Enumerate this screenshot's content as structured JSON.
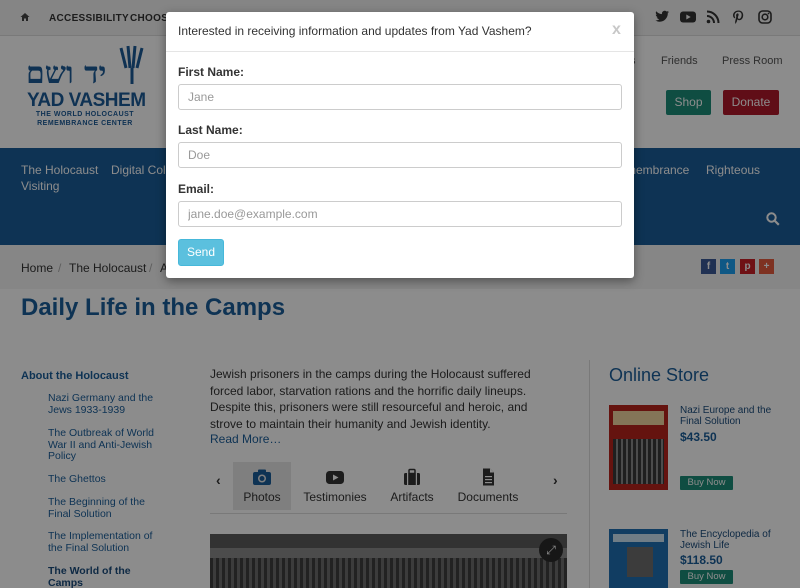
{
  "utility_bar": {
    "links": [
      "ACCESSIBILITY",
      "CHOOSE"
    ],
    "social_icons": [
      "twitter-icon",
      "youtube-icon",
      "rss-icon",
      "pinterest-icon",
      "instagram-icon"
    ]
  },
  "header": {
    "logo_hebrew": "יד ושם",
    "logo_english": "YAD VASHEM",
    "logo_subtitle": "THE WORLD HOLOCAUST REMEMBRANCE CENTER",
    "links": [
      "s",
      "Friends",
      "Press Room"
    ],
    "shop_label": "Shop",
    "donate_label": "Donate"
  },
  "nav": {
    "items_row1": [
      "The Holocaust",
      "Digital Colle",
      "membrance",
      "Righteous"
    ],
    "items_row2": [
      "Visiting"
    ]
  },
  "breadcrumb": {
    "items": [
      "Home",
      "The Holocaust",
      "A"
    ]
  },
  "page_title": "Daily Life in the Camps",
  "sidebar": {
    "heading": "About the Holocaust",
    "items": [
      "Nazi Germany and the Jews 1933-1939",
      "The Outbreak of World War II and Anti-Jewish Policy",
      "The Ghettos",
      "The Beginning of the Final Solution",
      "The Implementation of the Final Solution",
      "The World of the Camps"
    ]
  },
  "main": {
    "intro": "Jewish prisoners in the camps during the Holocaust suffered forced labor, starvation rations and the horrific daily lineups. Despite this, prisoners were still resourceful and heroic, and strove to maintain their humanity and Jewish identity.",
    "read_more": "Read More…",
    "tabs": [
      {
        "label": "Photos",
        "icon": "camera-icon"
      },
      {
        "label": "Testimonies",
        "icon": "youtube-icon"
      },
      {
        "label": "Artifacts",
        "icon": "suitcase-icon"
      },
      {
        "label": "Documents",
        "icon": "document-icon"
      }
    ]
  },
  "store": {
    "title": "Online Store",
    "books": [
      {
        "title": "Nazi Europe and the Final Solution",
        "price": "$43.50",
        "buy": "Buy Now",
        "cover_color": "#b8231c"
      },
      {
        "title": "The Encyclopedia of Jewish Life",
        "price": "$118.50",
        "buy": "Buy Now",
        "cover_color": "#1f6fb2"
      }
    ]
  },
  "modal": {
    "title": "Interested in receiving information and updates from Yad Vashem?",
    "close": "x",
    "fields": [
      {
        "label": "First Name:",
        "placeholder": "Jane"
      },
      {
        "label": "Last Name:",
        "placeholder": "Doe"
      },
      {
        "label": "Email:",
        "placeholder": "jane.doe@example.com"
      }
    ],
    "send_label": "Send"
  },
  "colors": {
    "brand_blue": "#1b5e9a",
    "shop_green": "#1c8c79",
    "donate_red": "#b0192b",
    "send_blue": "#5bc0de"
  }
}
